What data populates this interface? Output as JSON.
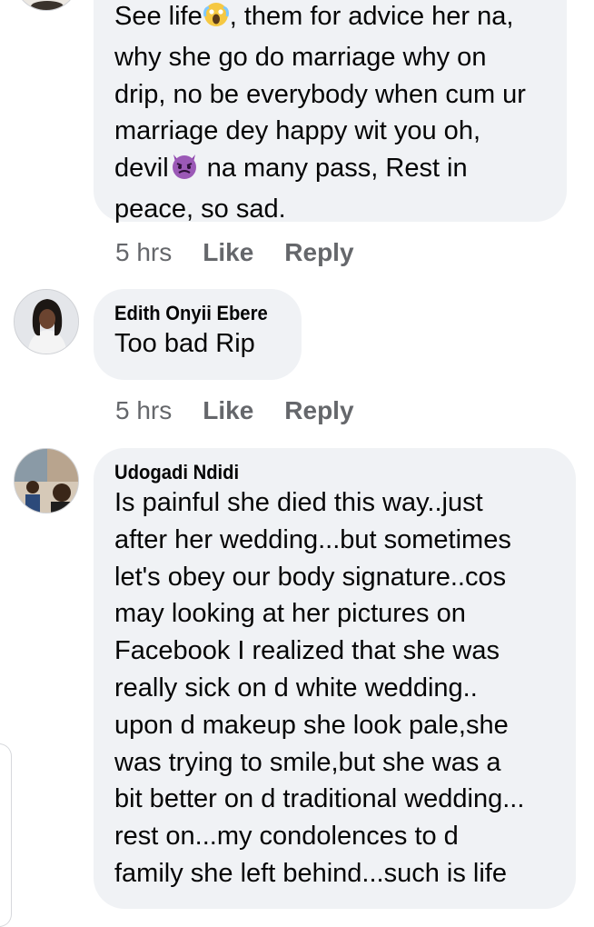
{
  "comments": [
    {
      "author": "",
      "lines_before_emoji_1": "See life",
      "line1_after": ", them for advice her na,",
      "lines": [
        "why she go do marriage why on",
        "drip, no be everybody when cum ur",
        "marriage dey happy wit you oh,"
      ],
      "line5_before": "devil",
      "line5_after": " na many pass, Rest in",
      "line6": "peace, so sad.",
      "emoji_1": "scream-face",
      "emoji_2": "angry-devil-face",
      "time": "5 hrs",
      "like_label": "Like",
      "reply_label": "Reply"
    },
    {
      "author": "Edith Onyii Ebere",
      "lines": [
        "Too bad Rip"
      ],
      "time": "5 hrs",
      "like_label": "Like",
      "reply_label": "Reply"
    },
    {
      "author": "Udogadi Ndidi",
      "lines": [
        "Is painful she died this way..just",
        "after her wedding...but sometimes",
        "let's obey our body signature..cos",
        "may looking at her pictures on",
        "Facebook I realized that she was",
        "really sick on d white wedding..",
        "upon d makeup she look pale,she",
        "was trying to smile,but she was a",
        "bit better on d traditional wedding...",
        "rest on...my condolences to d",
        "family she left behind...such is life"
      ]
    }
  ],
  "colors": {
    "bubble": "#f0f2f5",
    "meta_text": "#65676b",
    "body_text": "#050505"
  }
}
